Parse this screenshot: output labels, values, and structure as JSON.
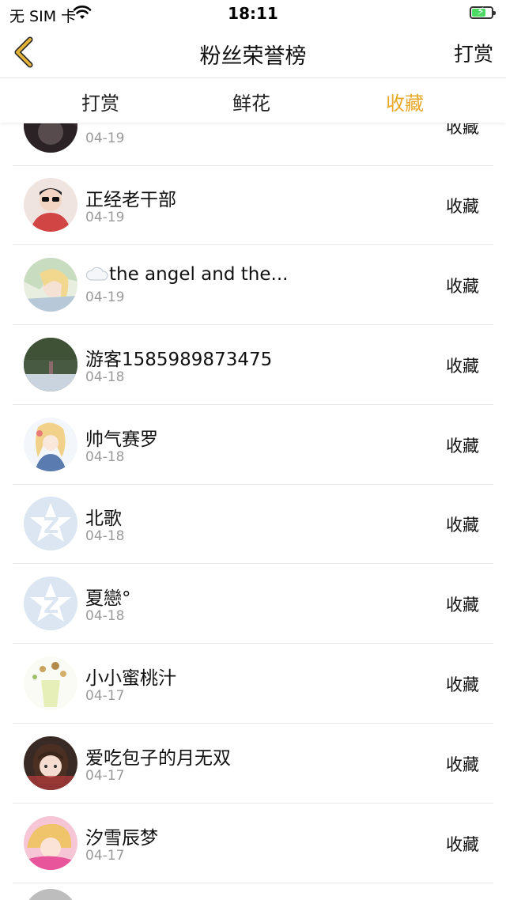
{
  "status_bar": {
    "carrier": "无 SIM 卡",
    "time": "18:11"
  },
  "nav": {
    "title": "粉丝荣誉榜",
    "right": "打赏"
  },
  "tabs": [
    {
      "label": "打赏",
      "active": false
    },
    {
      "label": "鲜花",
      "active": false
    },
    {
      "label": "收藏",
      "active": true
    }
  ],
  "colors": {
    "accent": "#e8a92a",
    "back_arrow": "#d9a82c",
    "default_avatar": "#dbe6f2"
  },
  "rows": [
    {
      "name": "",
      "date": "04-19",
      "action": "收藏",
      "avatar": "photo-dark"
    },
    {
      "name": "正经老干部",
      "date": "04-19",
      "action": "收藏",
      "avatar": "photo-boy"
    },
    {
      "name": "the angel and the...",
      "date": "04-19",
      "action": "收藏",
      "avatar": "photo-anime",
      "prefix_icon": "cloud-icon"
    },
    {
      "name": "游客1585989873475",
      "date": "04-18",
      "action": "收藏",
      "avatar": "photo-landscape"
    },
    {
      "name": "帅气赛罗",
      "date": "04-18",
      "action": "收藏",
      "avatar": "photo-anime-girl"
    },
    {
      "name": "北歌",
      "date": "04-18",
      "action": "收藏",
      "avatar": "default-star"
    },
    {
      "name": "夏戀°",
      "date": "04-18",
      "action": "收藏",
      "avatar": "default-star"
    },
    {
      "name": "小小蜜桃汁",
      "date": "04-17",
      "action": "收藏",
      "avatar": "photo-drink"
    },
    {
      "name": "爱吃包子的月无双",
      "date": "04-17",
      "action": "收藏",
      "avatar": "photo-character"
    },
    {
      "name": "汐雪辰梦",
      "date": "04-17",
      "action": "收藏",
      "avatar": "photo-pink"
    }
  ]
}
